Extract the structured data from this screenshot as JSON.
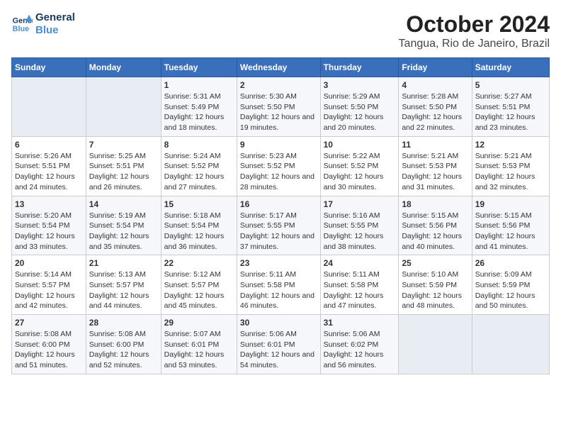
{
  "logo": {
    "line1": "General",
    "line2": "Blue"
  },
  "title": "October 2024",
  "location": "Tangua, Rio de Janeiro, Brazil",
  "weekdays": [
    "Sunday",
    "Monday",
    "Tuesday",
    "Wednesday",
    "Thursday",
    "Friday",
    "Saturday"
  ],
  "weeks": [
    [
      {
        "day": "",
        "info": ""
      },
      {
        "day": "",
        "info": ""
      },
      {
        "day": "1",
        "info": "Sunrise: 5:31 AM\nSunset: 5:49 PM\nDaylight: 12 hours and 18 minutes."
      },
      {
        "day": "2",
        "info": "Sunrise: 5:30 AM\nSunset: 5:50 PM\nDaylight: 12 hours and 19 minutes."
      },
      {
        "day": "3",
        "info": "Sunrise: 5:29 AM\nSunset: 5:50 PM\nDaylight: 12 hours and 20 minutes."
      },
      {
        "day": "4",
        "info": "Sunrise: 5:28 AM\nSunset: 5:50 PM\nDaylight: 12 hours and 22 minutes."
      },
      {
        "day": "5",
        "info": "Sunrise: 5:27 AM\nSunset: 5:51 PM\nDaylight: 12 hours and 23 minutes."
      }
    ],
    [
      {
        "day": "6",
        "info": "Sunrise: 5:26 AM\nSunset: 5:51 PM\nDaylight: 12 hours and 24 minutes."
      },
      {
        "day": "7",
        "info": "Sunrise: 5:25 AM\nSunset: 5:51 PM\nDaylight: 12 hours and 26 minutes."
      },
      {
        "day": "8",
        "info": "Sunrise: 5:24 AM\nSunset: 5:52 PM\nDaylight: 12 hours and 27 minutes."
      },
      {
        "day": "9",
        "info": "Sunrise: 5:23 AM\nSunset: 5:52 PM\nDaylight: 12 hours and 28 minutes."
      },
      {
        "day": "10",
        "info": "Sunrise: 5:22 AM\nSunset: 5:52 PM\nDaylight: 12 hours and 30 minutes."
      },
      {
        "day": "11",
        "info": "Sunrise: 5:21 AM\nSunset: 5:53 PM\nDaylight: 12 hours and 31 minutes."
      },
      {
        "day": "12",
        "info": "Sunrise: 5:21 AM\nSunset: 5:53 PM\nDaylight: 12 hours and 32 minutes."
      }
    ],
    [
      {
        "day": "13",
        "info": "Sunrise: 5:20 AM\nSunset: 5:54 PM\nDaylight: 12 hours and 33 minutes."
      },
      {
        "day": "14",
        "info": "Sunrise: 5:19 AM\nSunset: 5:54 PM\nDaylight: 12 hours and 35 minutes."
      },
      {
        "day": "15",
        "info": "Sunrise: 5:18 AM\nSunset: 5:54 PM\nDaylight: 12 hours and 36 minutes."
      },
      {
        "day": "16",
        "info": "Sunrise: 5:17 AM\nSunset: 5:55 PM\nDaylight: 12 hours and 37 minutes."
      },
      {
        "day": "17",
        "info": "Sunrise: 5:16 AM\nSunset: 5:55 PM\nDaylight: 12 hours and 38 minutes."
      },
      {
        "day": "18",
        "info": "Sunrise: 5:15 AM\nSunset: 5:56 PM\nDaylight: 12 hours and 40 minutes."
      },
      {
        "day": "19",
        "info": "Sunrise: 5:15 AM\nSunset: 5:56 PM\nDaylight: 12 hours and 41 minutes."
      }
    ],
    [
      {
        "day": "20",
        "info": "Sunrise: 5:14 AM\nSunset: 5:57 PM\nDaylight: 12 hours and 42 minutes."
      },
      {
        "day": "21",
        "info": "Sunrise: 5:13 AM\nSunset: 5:57 PM\nDaylight: 12 hours and 44 minutes."
      },
      {
        "day": "22",
        "info": "Sunrise: 5:12 AM\nSunset: 5:57 PM\nDaylight: 12 hours and 45 minutes."
      },
      {
        "day": "23",
        "info": "Sunrise: 5:11 AM\nSunset: 5:58 PM\nDaylight: 12 hours and 46 minutes."
      },
      {
        "day": "24",
        "info": "Sunrise: 5:11 AM\nSunset: 5:58 PM\nDaylight: 12 hours and 47 minutes."
      },
      {
        "day": "25",
        "info": "Sunrise: 5:10 AM\nSunset: 5:59 PM\nDaylight: 12 hours and 48 minutes."
      },
      {
        "day": "26",
        "info": "Sunrise: 5:09 AM\nSunset: 5:59 PM\nDaylight: 12 hours and 50 minutes."
      }
    ],
    [
      {
        "day": "27",
        "info": "Sunrise: 5:08 AM\nSunset: 6:00 PM\nDaylight: 12 hours and 51 minutes."
      },
      {
        "day": "28",
        "info": "Sunrise: 5:08 AM\nSunset: 6:00 PM\nDaylight: 12 hours and 52 minutes."
      },
      {
        "day": "29",
        "info": "Sunrise: 5:07 AM\nSunset: 6:01 PM\nDaylight: 12 hours and 53 minutes."
      },
      {
        "day": "30",
        "info": "Sunrise: 5:06 AM\nSunset: 6:01 PM\nDaylight: 12 hours and 54 minutes."
      },
      {
        "day": "31",
        "info": "Sunrise: 5:06 AM\nSunset: 6:02 PM\nDaylight: 12 hours and 56 minutes."
      },
      {
        "day": "",
        "info": ""
      },
      {
        "day": "",
        "info": ""
      }
    ]
  ]
}
